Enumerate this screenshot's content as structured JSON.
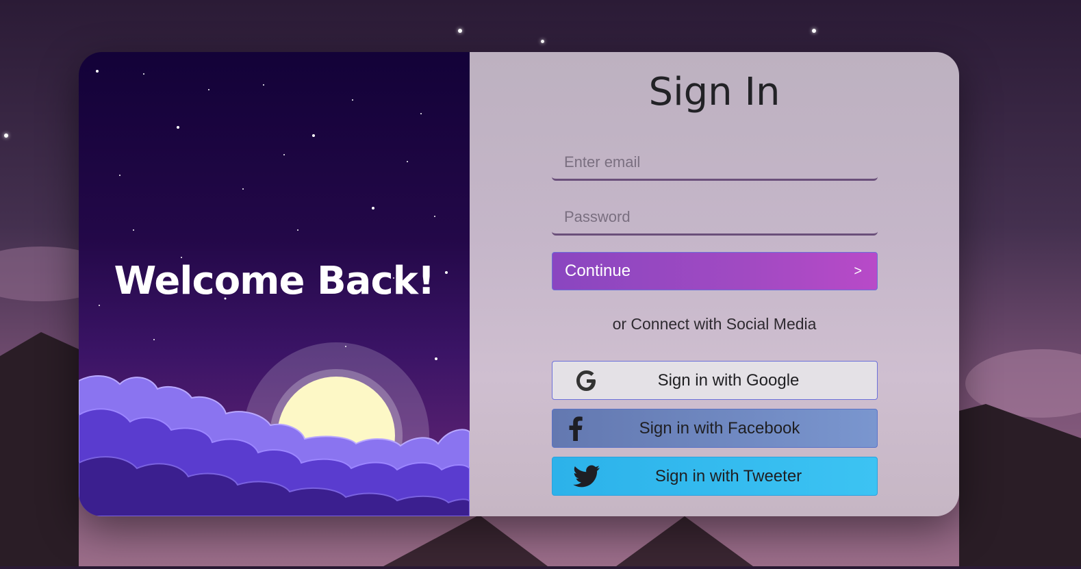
{
  "left_panel": {
    "welcome_text": "Welcome Back!"
  },
  "form": {
    "title": "Sign In",
    "email_placeholder": "Enter email",
    "password_placeholder": "Password",
    "continue_label": "Continue",
    "continue_arrow": ">",
    "social_text": "or Connect with Social Media"
  },
  "social": {
    "google_label": "Sign in with Google",
    "facebook_label": "Sign in with Facebook",
    "twitter_label": "Sign in with Tweeter"
  },
  "icons": {
    "google": "google-icon",
    "facebook": "facebook-icon",
    "twitter": "twitter-icon"
  },
  "colors": {
    "continue_start": "#8a46c0",
    "continue_end": "#b84ac8",
    "google_bg": "#e4e1e6",
    "facebook_bg": "#6b85c0",
    "twitter_bg": "#35bcef"
  }
}
